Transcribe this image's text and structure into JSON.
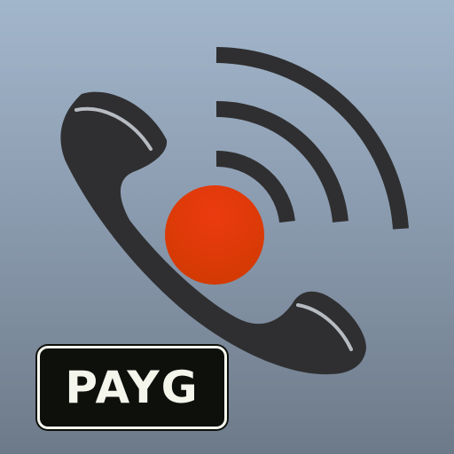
{
  "app_icon": {
    "badge_text": "PAYG",
    "icons": {
      "handset": "phone-handset-icon",
      "signal": "signal-waves-icon",
      "record": "record-dot-icon"
    },
    "colors": {
      "background_top": "#a2b6cb",
      "background_bottom": "#6d7a89",
      "handset": "#2f2f31",
      "record_dot": "#e03a0c",
      "badge_background": "#0e100c",
      "badge_text": "#f4f6ec"
    }
  }
}
